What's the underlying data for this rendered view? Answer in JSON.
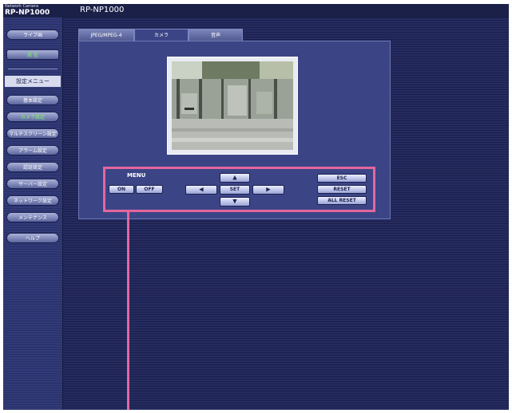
{
  "header": {
    "brand_small": "Network Camera",
    "brand_model": "RP-NP1000",
    "page_title": "RP-NP1000"
  },
  "sidebar": {
    "live": "ライブ画",
    "setup": "設 定",
    "menu_title": "設定メニュー",
    "items": [
      {
        "label": "基本設定",
        "active": false
      },
      {
        "label": "カメラ設定",
        "active": true
      },
      {
        "label": "マルチスクリーン設定",
        "active": false
      },
      {
        "label": "アラーム設定",
        "active": false
      },
      {
        "label": "認証設定",
        "active": false
      },
      {
        "label": "サーバー設定",
        "active": false
      },
      {
        "label": "ネットワーク設定",
        "active": false
      },
      {
        "label": "メンテナンス",
        "active": false
      }
    ],
    "help": "ヘルプ"
  },
  "tabs": [
    {
      "label": "JPEG/MPEG-4",
      "active": false
    },
    {
      "label": "カメラ",
      "active": true
    },
    {
      "label": "音声",
      "active": false
    }
  ],
  "controls": {
    "menu_label": "MENU",
    "on": "ON",
    "off": "OFF",
    "set": "SET",
    "esc": "ESC",
    "reset": "RESET",
    "all_reset": "ALL RESET",
    "up_icon": "▲",
    "down_icon": "▼",
    "left_icon": "◀",
    "right_icon": "▶"
  },
  "colors": {
    "accent_highlight": "#e4669e",
    "active_text": "#7ff06a",
    "panel_bg": "#3b4586"
  }
}
